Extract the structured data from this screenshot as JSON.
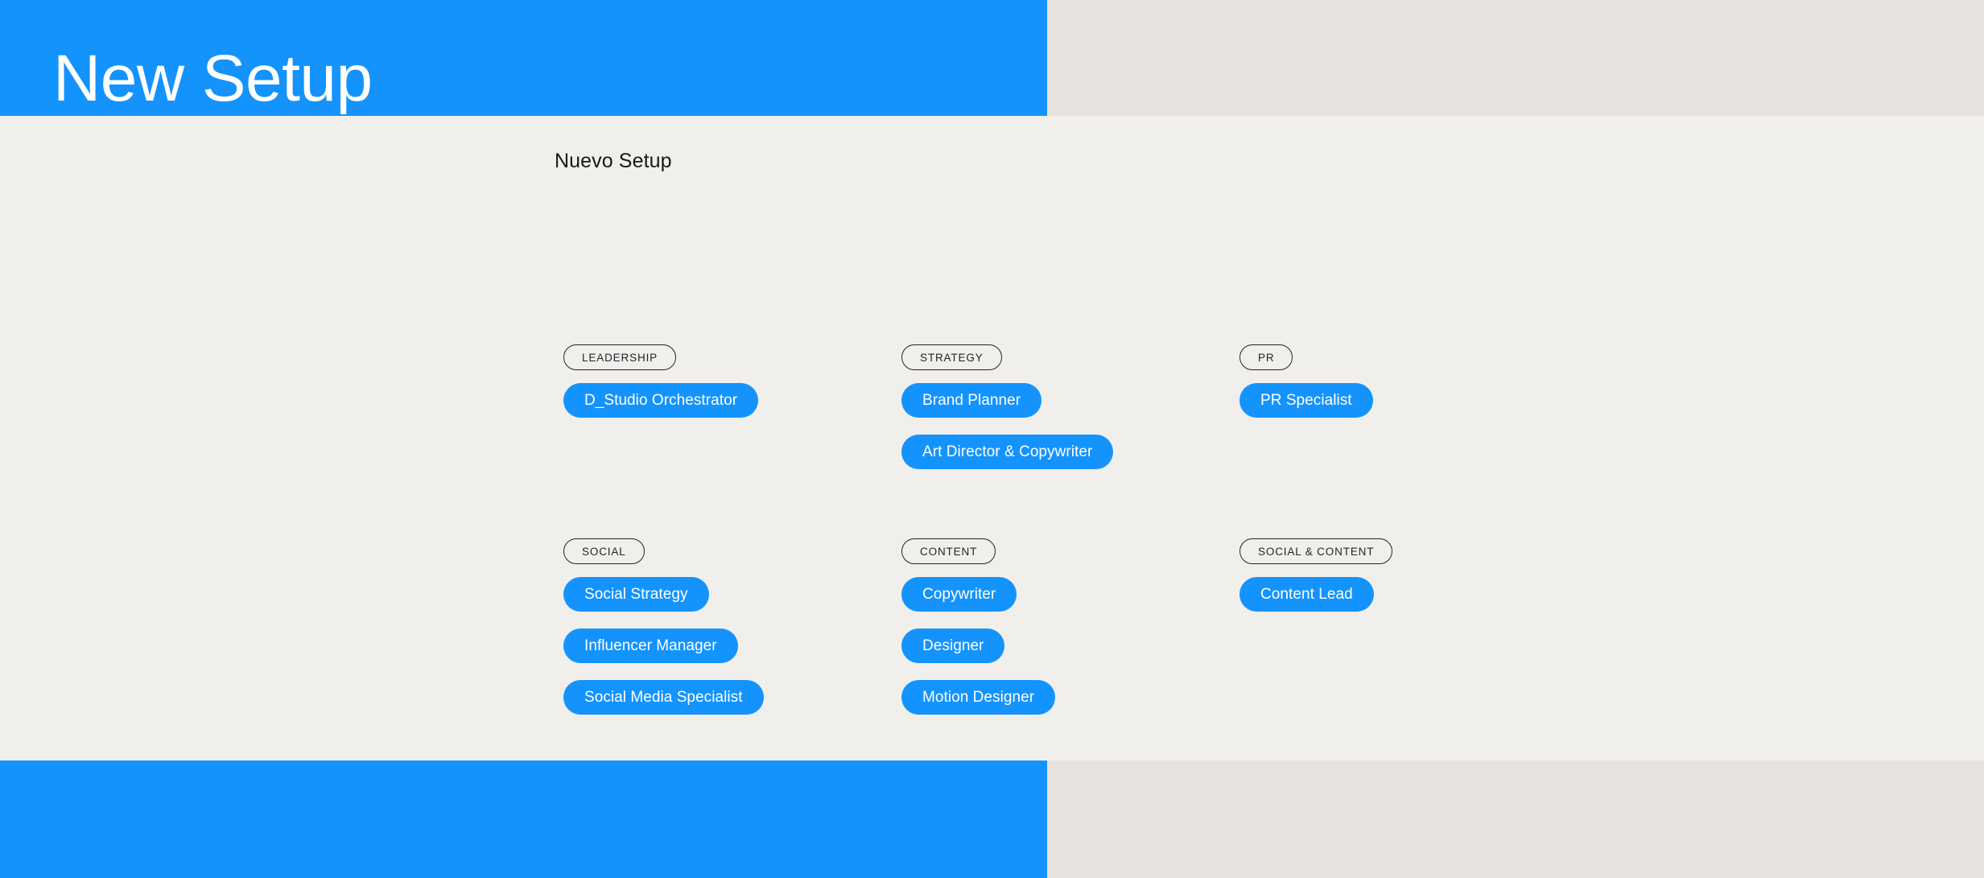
{
  "hero": {
    "title": "New Setup"
  },
  "card": {
    "title": "Nuevo Setup"
  },
  "colors": {
    "brand_blue": "#1493fd",
    "page_background": "#e7e2dd",
    "card_background": "#f1efec",
    "outline": "#22242a",
    "chip_text": "#ffffff"
  },
  "groups": [
    [
      {
        "tag": "LEADERSHIP",
        "roles": [
          "D_Studio Orchestrator"
        ]
      },
      {
        "tag": "STRATEGY",
        "roles": [
          "Brand Planner",
          "Art Director & Copywriter"
        ]
      },
      {
        "tag": "PR",
        "roles": [
          "PR Specialist"
        ]
      }
    ],
    [
      {
        "tag": "SOCIAL",
        "roles": [
          "Social Strategy",
          "Influencer Manager",
          "Social Media Specialist"
        ]
      },
      {
        "tag": "CONTENT",
        "roles": [
          "Copywriter",
          "Designer",
          "Motion Designer"
        ]
      },
      {
        "tag": "SOCIAL & CONTENT",
        "roles": [
          "Content Lead"
        ]
      }
    ]
  ]
}
